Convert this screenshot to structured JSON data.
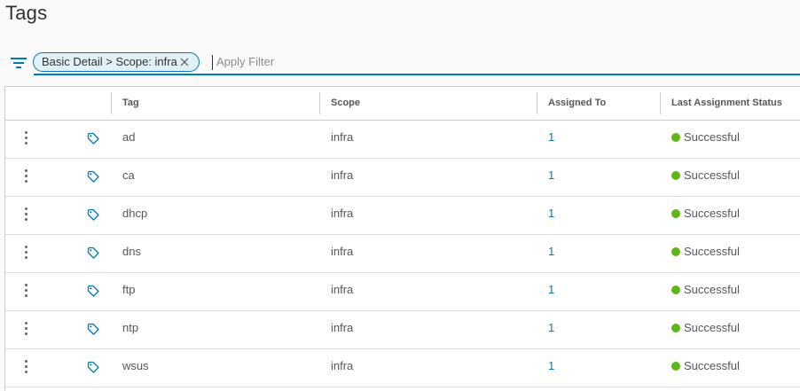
{
  "page": {
    "title": "Tags"
  },
  "filter": {
    "chip_label": "Basic Detail > Scope: infra",
    "input_placeholder": "Apply Filter"
  },
  "table": {
    "columns": [
      "Tag",
      "Scope",
      "Assigned To",
      "Last Assignment Status"
    ],
    "rows": [
      {
        "tag": "ad",
        "scope": "infra",
        "assigned_to": "1",
        "status": "Successful"
      },
      {
        "tag": "ca",
        "scope": "infra",
        "assigned_to": "1",
        "status": "Successful"
      },
      {
        "tag": "dhcp",
        "scope": "infra",
        "assigned_to": "1",
        "status": "Successful"
      },
      {
        "tag": "dns",
        "scope": "infra",
        "assigned_to": "1",
        "status": "Successful"
      },
      {
        "tag": "ftp",
        "scope": "infra",
        "assigned_to": "1",
        "status": "Successful"
      },
      {
        "tag": "ntp",
        "scope": "infra",
        "assigned_to": "1",
        "status": "Successful"
      },
      {
        "tag": "wsus",
        "scope": "infra",
        "assigned_to": "1",
        "status": "Successful"
      }
    ]
  },
  "icons": {
    "row_menu": "kebab-icon",
    "row_type": "tag-icon",
    "filter": "filter-icon",
    "chip_remove": "close-icon"
  },
  "colors": {
    "accent": "#0079b8",
    "success": "#5eb715",
    "chip_bg": "#e1f1f6"
  }
}
